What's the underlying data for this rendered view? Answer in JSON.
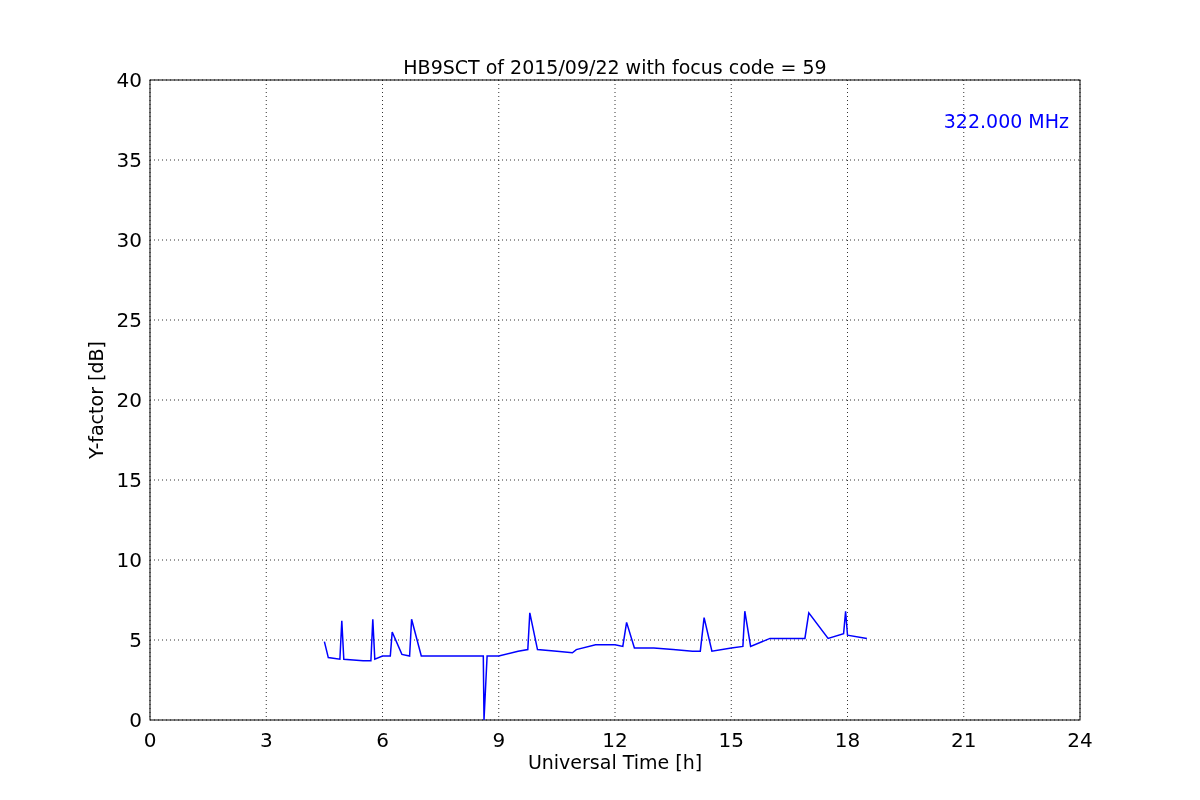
{
  "chart_data": {
    "type": "line",
    "title": "HB9SCT of 2015/09/22 with focus code = 59",
    "xlabel": "Universal Time [h]",
    "ylabel": "Y-factor [dB]",
    "x": [
      4.5,
      4.6,
      4.9,
      4.95,
      5.0,
      5.5,
      5.7,
      5.75,
      5.8,
      6.0,
      6.2,
      6.25,
      6.5,
      6.7,
      6.75,
      7.0,
      7.5,
      8.0,
      8.5,
      8.6,
      8.62,
      8.7,
      9.0,
      9.5,
      9.75,
      9.8,
      10.0,
      10.5,
      10.9,
      11.0,
      11.5,
      12.0,
      12.2,
      12.3,
      12.5,
      13.0,
      13.5,
      14.0,
      14.2,
      14.3,
      14.5,
      15.0,
      15.3,
      15.35,
      15.5,
      16.0,
      16.5,
      16.9,
      17.0,
      17.5,
      17.9,
      17.95,
      18.0,
      18.5
    ],
    "grid": true,
    "series": [
      {
        "color": "#0000ff",
        "values": [
          4.9,
          3.9,
          3.8,
          6.2,
          3.8,
          3.7,
          3.7,
          6.3,
          3.8,
          4.0,
          4.0,
          5.5,
          4.1,
          4.0,
          6.3,
          4.0,
          4.0,
          4.0,
          4.0,
          4.0,
          0,
          4.0,
          4.0,
          4.3,
          4.4,
          6.7,
          4.4,
          4.3,
          4.2,
          4.4,
          4.7,
          4.7,
          4.6,
          6.1,
          4.5,
          4.5,
          4.4,
          4.3,
          4.3,
          6.4,
          4.3,
          4.5,
          4.6,
          6.8,
          4.6,
          5.1,
          5.1,
          5.1,
          6.7,
          5.1,
          5.4,
          6.8,
          5.3,
          5.1
        ]
      }
    ],
    "xlim": [
      0,
      24
    ],
    "ylim": [
      0,
      40
    ],
    "xticks": [
      0,
      3,
      6,
      9,
      12,
      15,
      18,
      21,
      24
    ],
    "yticks": [
      0,
      5,
      10,
      15,
      20,
      25,
      30,
      35,
      40
    ],
    "annotations": [
      "322.000 MHz"
    ]
  }
}
